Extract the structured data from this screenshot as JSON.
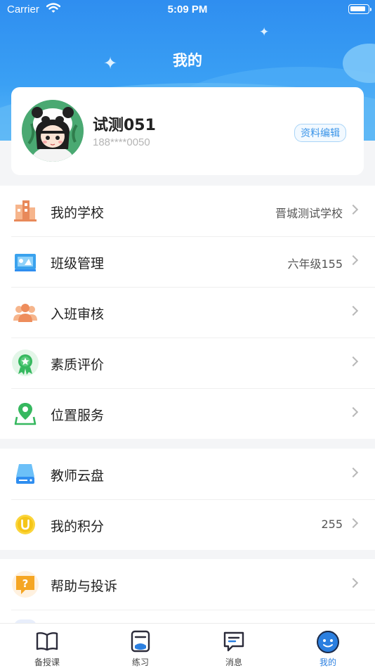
{
  "status_bar": {
    "carrier": "Carrier",
    "time": "5:09 PM"
  },
  "header": {
    "title": "我的"
  },
  "profile": {
    "name": "试测051",
    "phone": "188****0050",
    "edit_label": "资料编辑"
  },
  "menu_group_1": [
    {
      "label": "我的学校",
      "value": "晋城测试学校",
      "icon": "school-icon"
    },
    {
      "label": "班级管理",
      "value": "六年级155",
      "icon": "class-management-icon"
    },
    {
      "label": "入班审核",
      "value": "",
      "icon": "people-icon"
    },
    {
      "label": "素质评价",
      "value": "",
      "icon": "award-badge-icon"
    },
    {
      "label": "位置服务",
      "value": "",
      "icon": "location-pin-icon"
    }
  ],
  "menu_group_2": [
    {
      "label": "教师云盘",
      "value": "",
      "icon": "cloud-drive-icon"
    },
    {
      "label": "我的积分",
      "value": "255",
      "icon": "points-coin-icon"
    }
  ],
  "menu_group_3": [
    {
      "label": "帮助与投诉",
      "value": "",
      "icon": "help-chat-icon"
    }
  ],
  "tabbar": {
    "items": [
      {
        "label": "备授课",
        "icon": "book-icon"
      },
      {
        "label": "练习",
        "icon": "practice-icon"
      },
      {
        "label": "消息",
        "icon": "message-icon"
      },
      {
        "label": "我的",
        "icon": "profile-face-icon"
      }
    ],
    "active": "我的"
  },
  "colors": {
    "primary": "#2f8ef0",
    "accent_blue": "#2b7fe0",
    "background": "#f4f5f7"
  }
}
